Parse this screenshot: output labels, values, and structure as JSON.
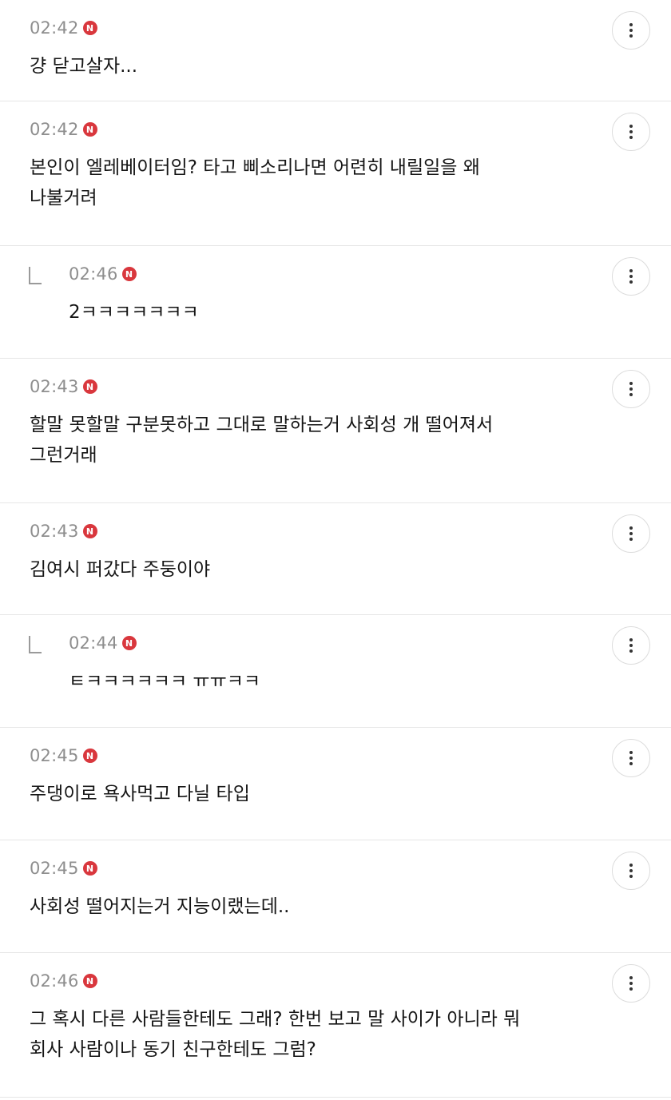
{
  "comments": [
    {
      "time": "02:42",
      "badge": "N",
      "text": "걍 닫고살자...",
      "reply": false
    },
    {
      "time": "02:42",
      "badge": "N",
      "text": "본인이 엘레베이터임? 타고 삐소리나면 어련히 내릴일을 왜\n나불거려",
      "reply": false
    },
    {
      "time": "02:46",
      "badge": "N",
      "text": "2ㅋㅋㅋㅋㅋㅋㅋ",
      "reply": true
    },
    {
      "time": "02:43",
      "badge": "N",
      "text": "할말 못할말 구분못하고 그대로 말하는거 사회성 개 떨어져서\n그런거래",
      "reply": false
    },
    {
      "time": "02:43",
      "badge": "N",
      "text": "김여시 퍼갔다 주둥이야",
      "reply": false
    },
    {
      "time": "02:44",
      "badge": "N",
      "text": "ㅌㅋㅋㅋㅋㅋㅋ ㅠㅠㅋㅋ",
      "reply": true
    },
    {
      "time": "02:45",
      "badge": "N",
      "text": "주댕이로 욕사먹고 다닐 타입",
      "reply": false
    },
    {
      "time": "02:45",
      "badge": "N",
      "text": "사회성 떨어지는거 지능이랬는데..",
      "reply": false
    },
    {
      "time": "02:46",
      "badge": "N",
      "text": "그 혹시 다른 사람들한테도 그래? 한번 보고 말 사이가 아니라 뭐\n회사 사람이나 동기 친구한테도 그럼?",
      "reply": false
    }
  ],
  "icons": {
    "more": "more-vertical-icon",
    "reply": "reply-arrow-icon"
  },
  "colors": {
    "badge": "#d9373d",
    "time": "#8e8e8e",
    "divider": "#e6e6e6"
  }
}
